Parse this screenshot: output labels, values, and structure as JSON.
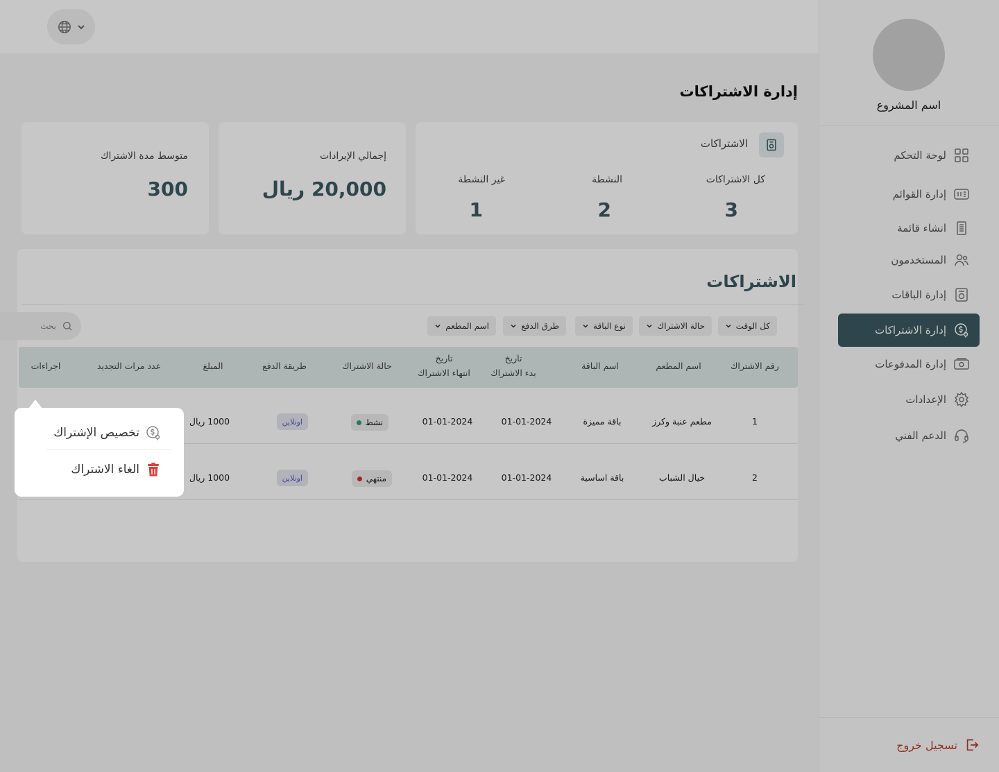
{
  "sidebar": {
    "project_name": "اسم المشروع",
    "items": [
      {
        "label": "لوحة التحكم",
        "icon": "grid-icon"
      },
      {
        "label": "إدارة القوائم",
        "icon": "menu-list-icon"
      },
      {
        "label": "انشاء قائمة",
        "icon": "document-icon"
      },
      {
        "label": "المستخدمون",
        "icon": "users-icon"
      },
      {
        "label": "إدارة الباقات",
        "icon": "package-icon"
      },
      {
        "label": "إدارة الاشتراكات",
        "icon": "subscription-icon",
        "active": true
      },
      {
        "label": "إدارة المدفوعات",
        "icon": "payments-icon"
      },
      {
        "label": "الإعدادات",
        "icon": "gear-icon"
      },
      {
        "label": "الدعم الفني",
        "icon": "headset-icon"
      }
    ],
    "logout": "تسجيل خروج"
  },
  "page": {
    "title": "إدارة الاشتراكات"
  },
  "stats": {
    "subscriptions": {
      "title": "الاشتراكات",
      "all_label": "كل الاشتراكات",
      "all_value": "3",
      "active_label": "النشطة",
      "active_value": "2",
      "inactive_label": "غير النشطة",
      "inactive_value": "1"
    },
    "revenue": {
      "label": "إجمالي الإيرادات",
      "value": "20,000 ريال"
    },
    "avg_duration": {
      "label": "متوسط مدة الاشتراك",
      "value": "300"
    }
  },
  "table_panel": {
    "title": "الاشتراكات",
    "filters": [
      "كل الوقت",
      "حالة الاشتراك",
      "نوع الباقة",
      "طرق الدفع",
      "اسم المطعم"
    ],
    "search_placeholder": "بحث",
    "columns": [
      "رقم الاشتراك",
      "اسم المطعم",
      "اسم الباقة",
      "تاريخ\nبدء الاشتراك",
      "تاريخ\nانتهاء الاشتراك",
      "حالة الاشتراك",
      "طريقة الدفع",
      "المبلغ",
      "عدد مرات التجديد",
      "اجراءات"
    ],
    "rows": [
      {
        "id": "1",
        "restaurant": "مطعم عنبة وكرز",
        "package": "باقة مميزة",
        "start": "01-01-2024",
        "end": "01-01-2024",
        "status": "نشط",
        "status_color": "#2e9e6b",
        "payment": "اونلاين",
        "amount": "1000 ريال"
      },
      {
        "id": "2",
        "restaurant": "خيال الشباب",
        "package": "باقة اساسية",
        "start": "01-01-2024",
        "end": "01-01-2024",
        "status": "منتهي",
        "status_color": "#d0342c",
        "payment": "اونلاين",
        "amount": "1000 ريال"
      }
    ]
  },
  "actions_menu": {
    "items": [
      {
        "label": "تخصيص الإشتراك",
        "icon": "dollar-badge-icon"
      },
      {
        "label": "الغاء الاشتراك",
        "icon": "trash-icon"
      }
    ]
  },
  "colors": {
    "accent": "#3c5a60",
    "danger": "#d0342c",
    "success": "#2e9e6b"
  }
}
